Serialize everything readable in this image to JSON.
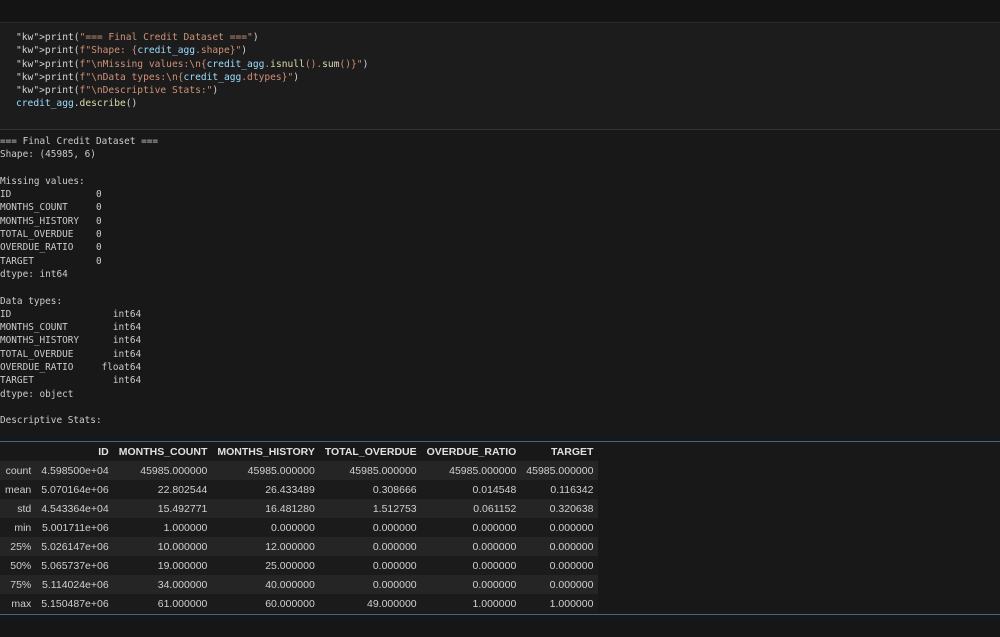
{
  "code_lines": [
    "print(\"=== Final Credit Dataset ===\")",
    "print(f\"Shape: {credit_agg.shape}\")",
    "print(f\"\\nMissing values:\\n{credit_agg.isnull().sum()}\")",
    "print(f\"\\nData types:\\n{credit_agg.dtypes}\")",
    "print(f\"\\nDescriptive Stats:\")",
    "credit_agg.describe()"
  ],
  "output_lines": [
    "=== Final Credit Dataset ===",
    "Shape: (45985, 6)",
    "",
    "Missing values:",
    "ID               0",
    "MONTHS_COUNT     0",
    "MONTHS_HISTORY   0",
    "TOTAL_OVERDUE    0",
    "OVERDUE_RATIO    0",
    "TARGET           0",
    "dtype: int64",
    "",
    "Data types:",
    "ID                  int64",
    "MONTHS_COUNT        int64",
    "MONTHS_HISTORY      int64",
    "TOTAL_OVERDUE       int64",
    "OVERDUE_RATIO     float64",
    "TARGET              int64",
    "dtype: object",
    "",
    "Descriptive Stats:"
  ],
  "table": {
    "columns": [
      "",
      "ID",
      "MONTHS_COUNT",
      "MONTHS_HISTORY",
      "TOTAL_OVERDUE",
      "OVERDUE_RATIO",
      "TARGET"
    ],
    "rows": [
      [
        "count",
        "4.598500e+04",
        "45985.000000",
        "45985.000000",
        "45985.000000",
        "45985.000000",
        "45985.000000"
      ],
      [
        "mean",
        "5.070164e+06",
        "22.802544",
        "26.433489",
        "0.308666",
        "0.014548",
        "0.116342"
      ],
      [
        "std",
        "4.543364e+04",
        "15.492771",
        "16.481280",
        "1.512753",
        "0.061152",
        "0.320638"
      ],
      [
        "min",
        "5.001711e+06",
        "1.000000",
        "0.000000",
        "0.000000",
        "0.000000",
        "0.000000"
      ],
      [
        "25%",
        "5.026147e+06",
        "10.000000",
        "12.000000",
        "0.000000",
        "0.000000",
        "0.000000"
      ],
      [
        "50%",
        "5.065737e+06",
        "19.000000",
        "25.000000",
        "0.000000",
        "0.000000",
        "0.000000"
      ],
      [
        "75%",
        "5.114024e+06",
        "34.000000",
        "40.000000",
        "0.000000",
        "0.000000",
        "0.000000"
      ],
      [
        "max",
        "5.150487e+06",
        "61.000000",
        "60.000000",
        "49.000000",
        "1.000000",
        "1.000000"
      ]
    ]
  }
}
